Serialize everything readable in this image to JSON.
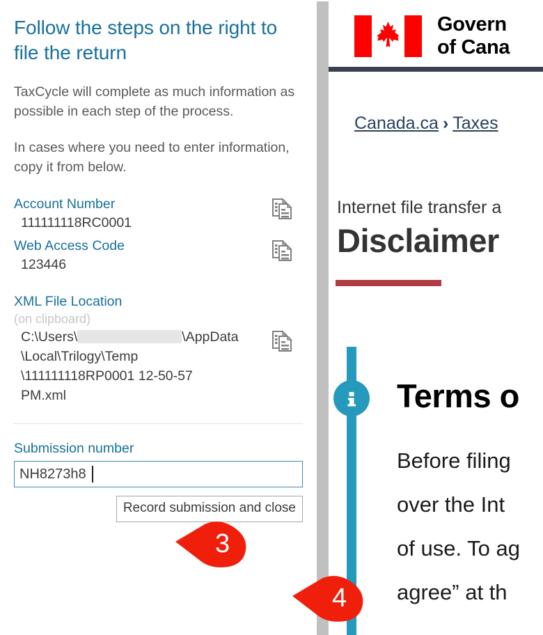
{
  "left_panel": {
    "title": "Follow the steps on the right to file the return",
    "paragraph_1": "TaxCycle will complete as much information as possible in each step of the process.",
    "paragraph_2": "In cases where you need to enter information, copy it from below.",
    "fields": [
      {
        "label": "Account Number",
        "value": "111111118RC0001",
        "copy_icon": "copy-icon"
      },
      {
        "label": "Web Access Code",
        "value": "123446",
        "copy_icon": "copy-icon"
      }
    ],
    "xml_field": {
      "label": "XML File Location",
      "sublabel": "(on clipboard)",
      "value_line_1_prefix": "C:\\Users\\",
      "value_line_1_suffix": "\\AppData",
      "value_line_2": "\\Local\\Trilogy\\Temp",
      "value_line_3": "\\111111118RP0001 12-50-57",
      "value_line_4": "PM.xml",
      "copy_icon": "copy-icon"
    },
    "submission": {
      "label": "Submission number",
      "value": "NH8273h8",
      "placeholder": "",
      "button_label": "Record submission and close"
    }
  },
  "right_panel": {
    "header": {
      "flag_icon": "canada-flag-icon",
      "wordmark_line_1": "Govern",
      "wordmark_line_2": "of Cana"
    },
    "breadcrumb": {
      "items": [
        "Canada.ca",
        "Taxes"
      ],
      "separator": "›"
    },
    "page_kicker": "Internet file transfer a",
    "page_title": "Disclaimer",
    "terms": {
      "info_icon": "info-circle-icon",
      "heading": "Terms o",
      "body_lines": [
        "Before filing",
        "over the Int",
        "of use. To ag",
        "agree” at th"
      ]
    }
  },
  "callouts": [
    {
      "number": "3",
      "target": "submission-number-input"
    },
    {
      "number": "4",
      "target": "record-submission-button"
    }
  ],
  "colors": {
    "accent_teal": "#17709c",
    "info_teal": "#269abc",
    "callout_red": "#f01f0c",
    "canada_red": "#ff0000",
    "rule_red": "#af3c43",
    "header_dark": "#38414d",
    "link_navy": "#284162"
  }
}
